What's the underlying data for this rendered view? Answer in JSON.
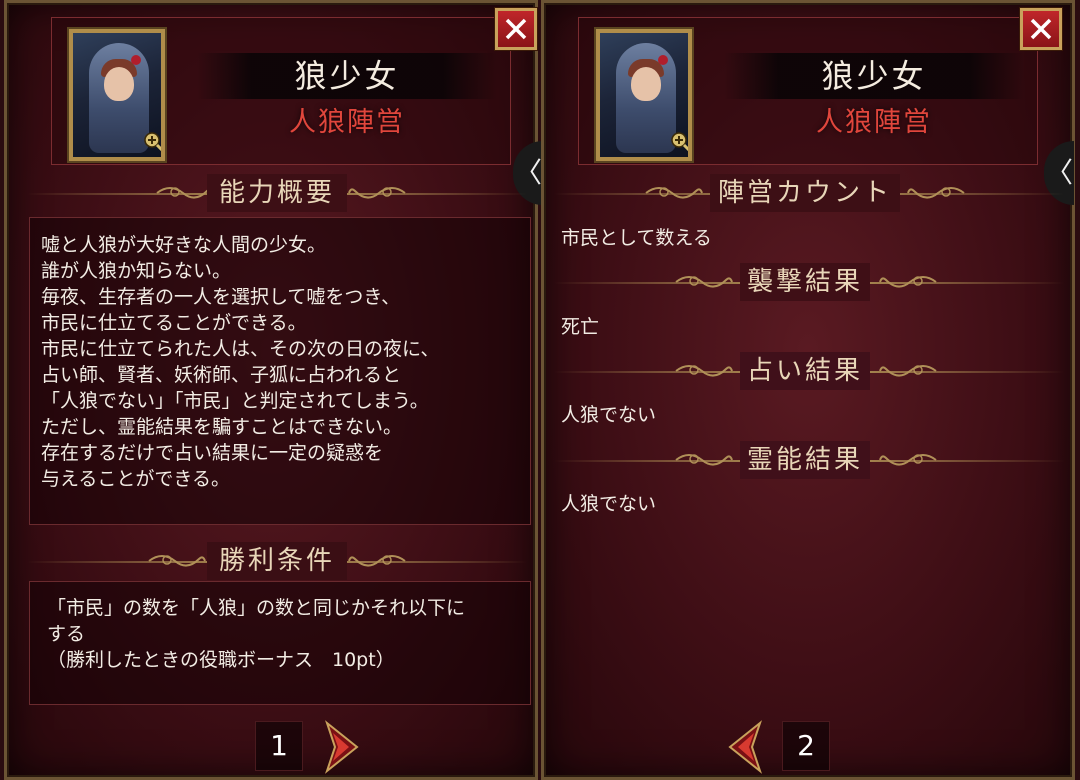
{
  "panels": [
    {
      "role_name": "狼少女",
      "faction": "人狼陣営",
      "close_glyph": "✕",
      "side_tab_glyph": "〈",
      "sections": {
        "ability_title": "能力概要",
        "ability_lines": [
          "嘘と人狼が大好きな人間の少女。",
          "誰が人狼か知らない。",
          "毎夜、生存者の一人を選択して嘘をつき、",
          "市民に仕立てることができる。",
          "市民に仕立てられた人は、その次の日の夜に、",
          "占い師、賢者、妖術師、子狐に占われると",
          "「人狼でない」「市民」と判定されてしまう。",
          "ただし、霊能結果を騙すことはできない。",
          "存在するだけで占い結果に一定の疑惑を",
          "与えることができる。"
        ],
        "victory_title": "勝利条件",
        "victory_lines": [
          "「市民」の数を「人狼」の数と同じかそれ以下に",
          "する",
          "（勝利したときの役職ボーナス　10pt）"
        ]
      },
      "page": "1"
    },
    {
      "role_name": "狼少女",
      "faction": "人狼陣営",
      "close_glyph": "✕",
      "side_tab_glyph": "〈",
      "sections": {
        "count_title": "陣営カウント",
        "count_value": "市民として数える",
        "attack_title": "襲撃結果",
        "attack_value": "死亡",
        "divine_title": "占い結果",
        "divine_value": "人狼でない",
        "medium_title": "霊能結果",
        "medium_value": "人狼でない"
      },
      "page": "2"
    }
  ],
  "colors": {
    "faction_red": "#e0463c",
    "gold_frame": "#b08d4a",
    "close_red": "#c0262a"
  },
  "icons": {
    "close": "close-icon",
    "zoom": "zoom-plus-icon",
    "next": "next-page-arrow-icon",
    "prev": "prev-page-arrow-icon",
    "side_tab": "chevron-left-icon"
  }
}
